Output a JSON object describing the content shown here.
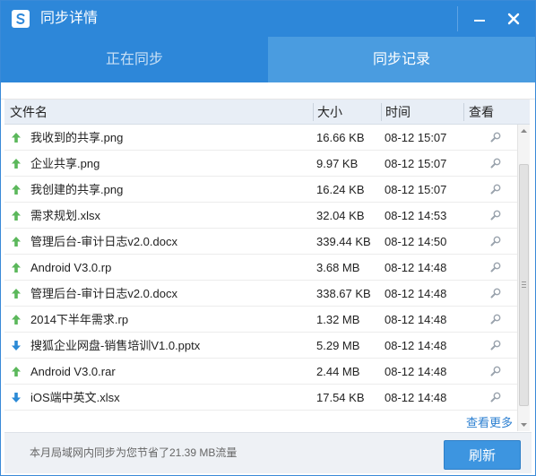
{
  "window": {
    "title": "同步详情",
    "minimize_icon": "minimize-icon",
    "close_icon": "close-icon"
  },
  "tabs": [
    {
      "label": "正在同步",
      "active": false
    },
    {
      "label": "同步记录",
      "active": true
    }
  ],
  "table": {
    "columns": {
      "name": "文件名",
      "size": "大小",
      "time": "时间",
      "view": "查看"
    },
    "rows": [
      {
        "direction": "upload",
        "name": "我收到的共享.png",
        "size": "16.66 KB",
        "time": "08-12 15:07"
      },
      {
        "direction": "upload",
        "name": "企业共享.png",
        "size": "9.97 KB",
        "time": "08-12 15:07"
      },
      {
        "direction": "upload",
        "name": "我创建的共享.png",
        "size": "16.24 KB",
        "time": "08-12 15:07"
      },
      {
        "direction": "upload",
        "name": "需求规划.xlsx",
        "size": "32.04 KB",
        "time": "08-12 14:53"
      },
      {
        "direction": "upload",
        "name": "管理后台-审计日志v2.0.docx",
        "size": "339.44 KB",
        "time": "08-12 14:50"
      },
      {
        "direction": "upload",
        "name": "Android V3.0.rp",
        "size": "3.68 MB",
        "time": "08-12 14:48"
      },
      {
        "direction": "upload",
        "name": "管理后台-审计日志v2.0.docx",
        "size": "338.67 KB",
        "time": "08-12 14:48"
      },
      {
        "direction": "upload",
        "name": "2014下半年需求.rp",
        "size": "1.32 MB",
        "time": "08-12 14:48"
      },
      {
        "direction": "download",
        "name": "搜狐企业网盘-销售培训V1.0.pptx",
        "size": "5.29 MB",
        "time": "08-12 14:48"
      },
      {
        "direction": "upload",
        "name": "Android V3.0.rar",
        "size": "2.44 MB",
        "time": "08-12 14:48"
      },
      {
        "direction": "download",
        "name": "iOS端中英文.xlsx",
        "size": "17.54 KB",
        "time": "08-12 14:48"
      }
    ]
  },
  "icons": {
    "upload": "upload-arrow-icon",
    "download": "download-arrow-icon",
    "view": "magnifier-icon"
  },
  "colors": {
    "accent": "#2d87d9",
    "tab_active": "#4a9ce0",
    "upload_arrow": "#5cb85c",
    "download_arrow": "#2b8ad6",
    "link": "#2b7fd1"
  },
  "more_link": "查看更多",
  "footer": {
    "message": "本月局域网内同步为您节省了21.39 MB流量",
    "refresh_label": "刷新"
  }
}
